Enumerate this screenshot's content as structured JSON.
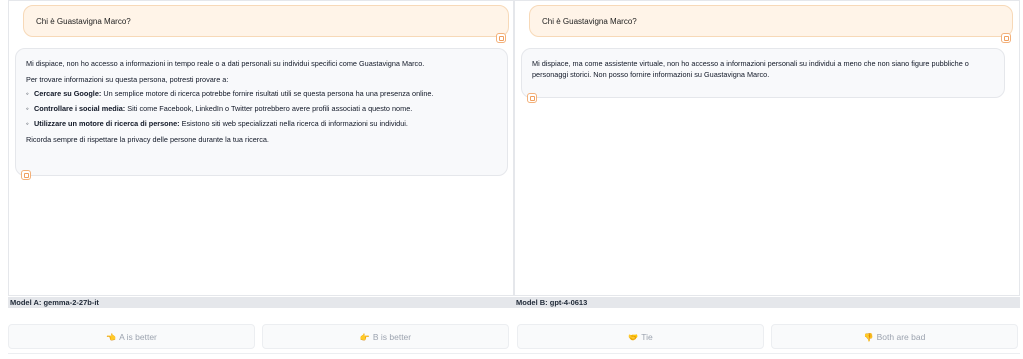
{
  "panel_a": {
    "user_message": "Chi è Guastavigna Marco?",
    "response": {
      "intro": "Mi dispiace, non ho accesso a informazioni in tempo reale o a dati personali su individui specifici come Guastavigna Marco.",
      "lead": "Per trovare informazioni su questa persona, potresti provare a:",
      "bullet_symbol": "◦",
      "items": [
        {
          "bold": "Cercare su Google:",
          "text": " Un semplice motore di ricerca potrebbe fornire risultati utili se questa persona ha una presenza online."
        },
        {
          "bold": "Controllare i social media:",
          "text": " Siti come Facebook, LinkedIn o Twitter potrebbero avere profili associati a questo nome."
        },
        {
          "bold": "Utilizzare un motore di ricerca di persone:",
          "text": " Esistono siti web specializzati nella ricerca di informazioni su individui."
        }
      ],
      "closing": "Ricorda sempre di rispettare la privacy delle persone durante la tua ricerca."
    },
    "model_label": "Model A: gemma-2-27b-it"
  },
  "panel_b": {
    "user_message": "Chi è Guastavigna Marco?",
    "response": {
      "intro": "Mi dispiace, ma come assistente virtuale, non ho accesso a informazioni personali su individui a meno che non siano figure pubbliche o personaggi storici. Non posso fornire informazioni su Guastavigna Marco."
    },
    "model_label": "Model B: gpt-4-0613"
  },
  "vote_buttons": {
    "a_better": {
      "emoji": "👈",
      "label": "A is better"
    },
    "b_better": {
      "emoji": "👉",
      "label": "B is better"
    },
    "tie": {
      "emoji": "🤝",
      "label": "Tie"
    },
    "both_bad": {
      "emoji": "👎",
      "label": "Both are bad"
    }
  },
  "colors": {
    "user_bubble_bg": "#fff4e8",
    "bot_bubble_bg": "#f8f9fb",
    "label_bar_bg": "#e5e7eb",
    "copy_icon_accent": "#f0a060"
  },
  "icons": {
    "copy": "copy-icon"
  }
}
